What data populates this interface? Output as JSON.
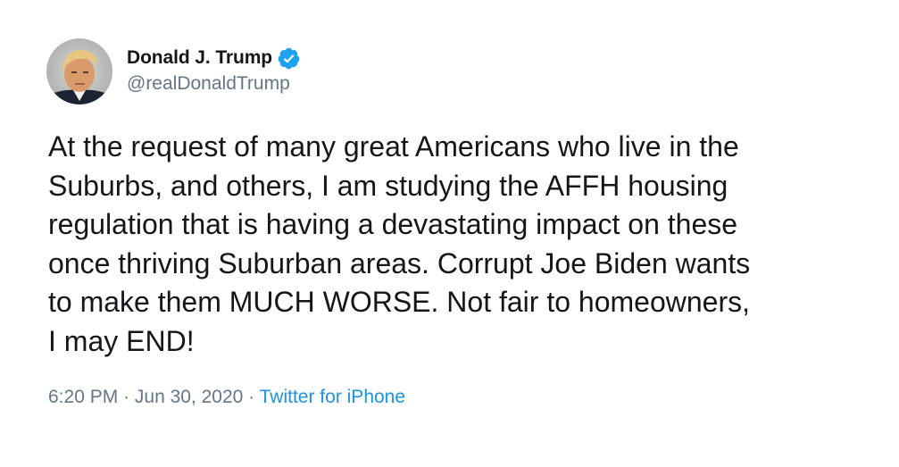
{
  "user": {
    "display_name": "Donald J. Trump",
    "handle": "@realDonaldTrump",
    "verified": true,
    "avatar_icon": "profile-photo-icon",
    "verified_icon": "verified-badge-icon"
  },
  "tweet": {
    "text": "At the request of many great Americans who live in the\nSuburbs, and others, I am studying the AFFH housing\nregulation that is having a devastating impact on these\nonce thriving Suburban areas. Corrupt Joe Biden wants\nto make them MUCH WORSE. Not fair to homeowners,\nI may END!",
    "time": "6:20 PM",
    "date": "Jun 30, 2020",
    "separator": " · ",
    "source": "Twitter for iPhone"
  },
  "colors": {
    "text": "#14171a",
    "secondary": "#657786",
    "link": "#1b95e0",
    "verified": "#1da1f2"
  }
}
